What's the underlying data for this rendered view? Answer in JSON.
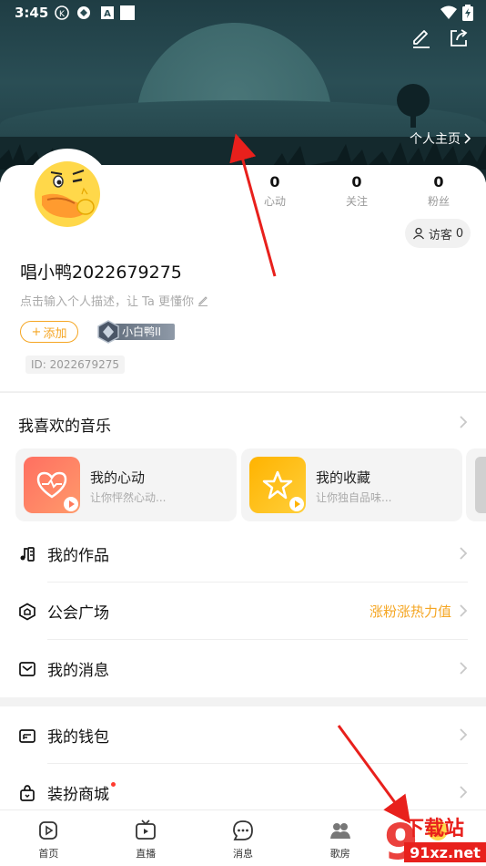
{
  "status_bar": {
    "time": "3:45",
    "icons": [
      "k-icon",
      "sync-icon",
      "a-icon",
      "square-icon"
    ],
    "right_icons": [
      "wifi-icon",
      "battery-icon"
    ]
  },
  "header": {
    "actions": [
      "edit-icon",
      "share-icon"
    ],
    "home_link": "个人主页",
    "colors": {
      "banner": "#1f3d44"
    }
  },
  "profile": {
    "stats": [
      {
        "value": "0",
        "label": "心动"
      },
      {
        "value": "0",
        "label": "关注"
      },
      {
        "value": "0",
        "label": "粉丝"
      }
    ],
    "visitor_label": "访客",
    "visitor_count": "0",
    "username": "唱小鸭2022679275",
    "bio_placeholder": "点击输入个人描述，让 Ta 更懂你",
    "add_label": "添加",
    "level_label": "小白鸭II",
    "id_text": "ID: 2022679275"
  },
  "music": {
    "title": "我喜欢的音乐",
    "cards": [
      {
        "title": "我的心动",
        "subtitle": "让你怦然心动...",
        "color": "#ff7a5c"
      },
      {
        "title": "我的收藏",
        "subtitle": "让你独自品味...",
        "color": "#ffc21a"
      }
    ]
  },
  "menu_group1": [
    {
      "label": "我的作品",
      "icon": "music-note-icon",
      "extra": ""
    },
    {
      "label": "公会广场",
      "icon": "guild-icon",
      "extra": "涨粉涨热力值"
    },
    {
      "label": "我的消息",
      "icon": "message-icon",
      "extra": ""
    }
  ],
  "menu_group2": [
    {
      "label": "我的钱包",
      "icon": "wallet-icon",
      "extra": ""
    },
    {
      "label": "装扮商城",
      "icon": "shop-icon",
      "extra": ""
    }
  ],
  "bottom_nav": [
    {
      "label": "首页",
      "icon": "home-play-icon"
    },
    {
      "label": "直播",
      "icon": "tv-icon"
    },
    {
      "label": "消息",
      "icon": "chat-icon"
    },
    {
      "label": "歌房",
      "icon": "group-icon"
    }
  ],
  "watermark": {
    "text_top": "下载站",
    "text_bottom": "91xz.net"
  },
  "accent_color": "#f5a623"
}
